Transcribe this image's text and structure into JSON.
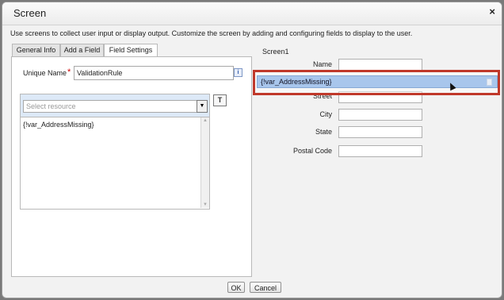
{
  "dialog": {
    "title": "Screen",
    "close_label": "×",
    "instructions": "Use screens to collect user input or display output. Customize the screen by adding and configuring fields to display to the user."
  },
  "tabs": [
    {
      "label": "General Info",
      "active": false
    },
    {
      "label": "Add a Field",
      "active": false
    },
    {
      "label": "Field Settings",
      "active": true
    }
  ],
  "field_settings": {
    "unique_name_label": "Unique Name",
    "required_marker": "*",
    "unique_name_value": "ValidationRule",
    "info_icon": "i",
    "select_placeholder": "Select resource",
    "select_arrow": "▼",
    "resource_text": "{!var_AddressMissing}",
    "insert_icon": "T"
  },
  "canvas": {
    "screen_name": "Screen1",
    "fields": [
      {
        "label": "Name"
      },
      {
        "label": "Street"
      },
      {
        "label": "City"
      },
      {
        "label": "State"
      },
      {
        "label": "Postal Code"
      }
    ],
    "dragged_item": "{!var_AddressMissing}",
    "highlight_color": "#c0392b"
  },
  "footer": {
    "ok_label": "OK",
    "cancel_label": "Cancel"
  }
}
